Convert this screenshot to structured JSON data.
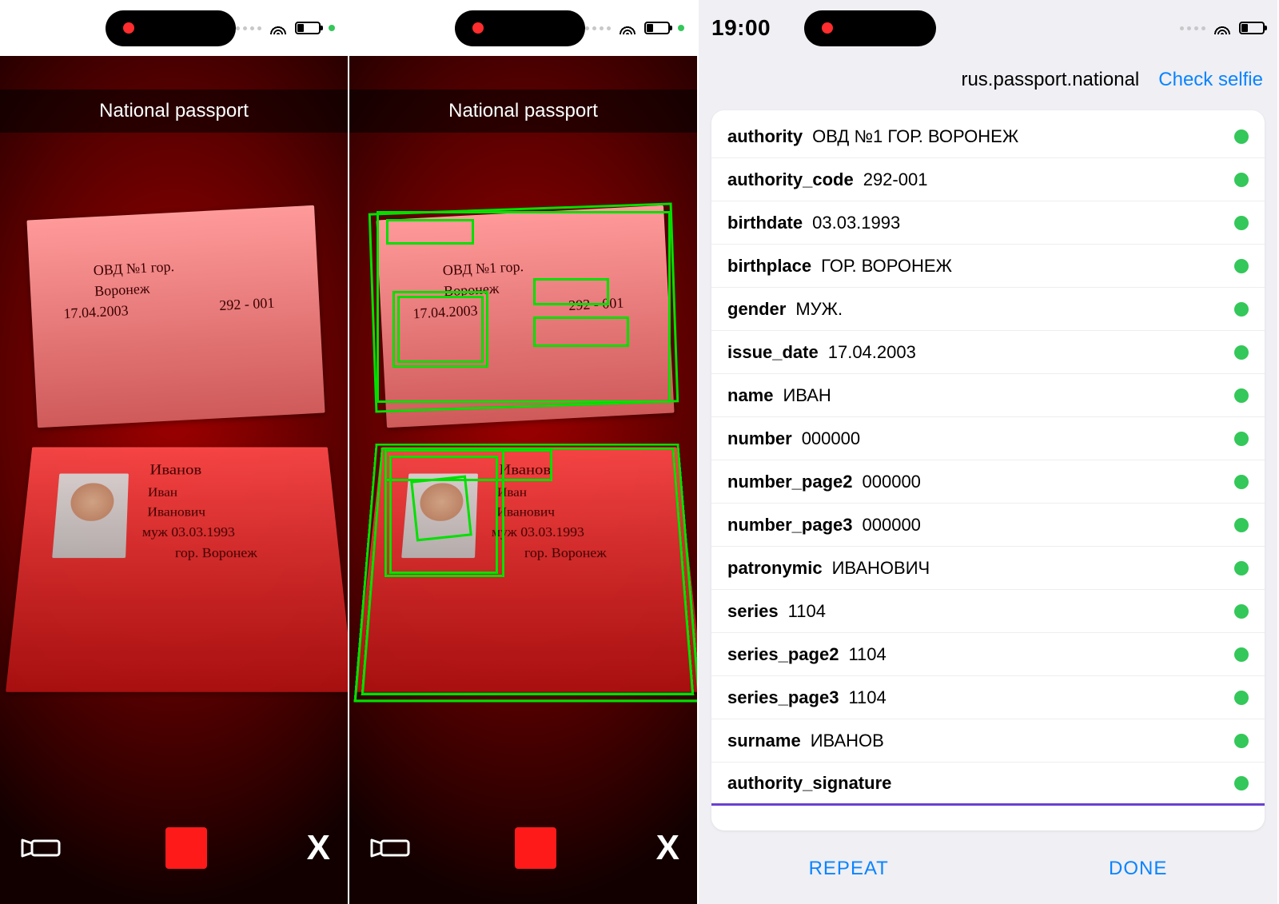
{
  "status": {
    "time": "19:00"
  },
  "camera": {
    "title": "National passport",
    "doc_top": {
      "line1": "ОВД  №1   гор.",
      "line2": "Воронеж",
      "date": "17.04.2003",
      "code": "292 - 001"
    },
    "doc_bottom": {
      "surname": "Иванов",
      "name": "Иван",
      "patronymic": "Иванович",
      "gender_dob": "муж   03.03.1993",
      "birthplace": "гор. Воронеж"
    }
  },
  "results": {
    "doc_type": "rus.passport.national",
    "check_selfie": "Check selfie",
    "fields": [
      {
        "key": "authority",
        "value": "ОВД №1 ГОР. ВОРОНЕЖ"
      },
      {
        "key": "authority_code",
        "value": "292-001"
      },
      {
        "key": "birthdate",
        "value": "03.03.1993"
      },
      {
        "key": "birthplace",
        "value": "ГОР. ВОРОНЕЖ"
      },
      {
        "key": "gender",
        "value": "МУЖ."
      },
      {
        "key": "issue_date",
        "value": "17.04.2003"
      },
      {
        "key": "name",
        "value": "ИВАН"
      },
      {
        "key": "number",
        "value": "000000"
      },
      {
        "key": "number_page2",
        "value": "000000"
      },
      {
        "key": "number_page3",
        "value": "000000"
      },
      {
        "key": "patronymic",
        "value": "ИВАНОВИЧ"
      },
      {
        "key": "series",
        "value": "1104"
      },
      {
        "key": "series_page2",
        "value": "1104"
      },
      {
        "key": "series_page3",
        "value": "1104"
      },
      {
        "key": "surname",
        "value": "ИВАНОВ"
      },
      {
        "key": "authority_signature",
        "value": ""
      }
    ],
    "repeat": "REPEAT",
    "done": "DONE"
  }
}
